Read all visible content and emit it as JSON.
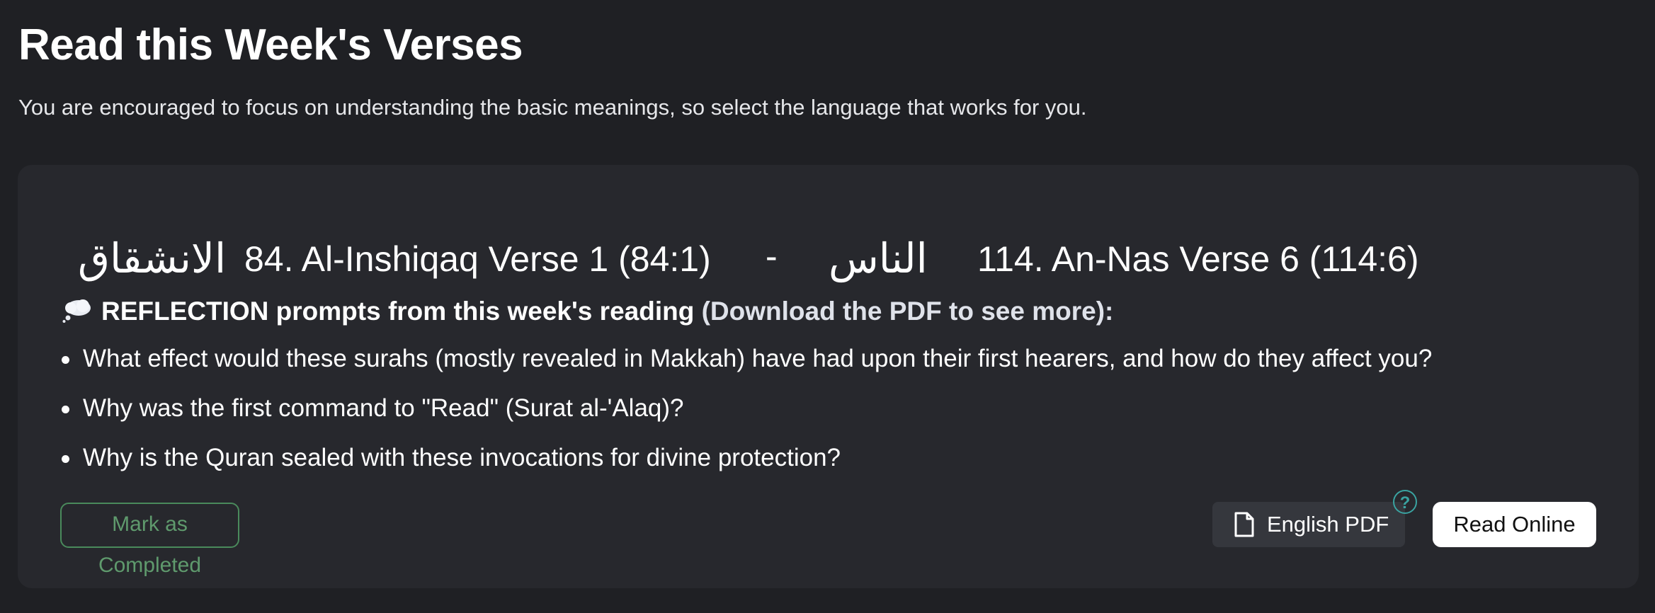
{
  "header": {
    "title": "Read this Week's Verses",
    "subtitle": "You are encouraged to focus on understanding the basic meanings, so select the language that works for you."
  },
  "card": {
    "range": {
      "start": {
        "arabic_name": "الانشقاق",
        "label": "84. Al-Inshiqaq Verse 1 (84:1)"
      },
      "separator": "-",
      "end": {
        "arabic_name": "الناس",
        "label": "114. An-Nas Verse 6 (114:6)"
      }
    },
    "reflection": {
      "icon": "thought-bubble-icon",
      "heading": "REFLECTION prompts from this week's reading",
      "download_note": "(Download the PDF to see more):",
      "prompts": [
        "What effect would these surahs (mostly revealed in Makkah) have had upon their first hearers, and how do they affect you?",
        "Why was the first command to \"Read\" (Surat al-'Alaq)?",
        "Why is the Quran sealed with these invocations for divine protection?"
      ]
    },
    "actions": {
      "mark_completed": "Mark as Completed",
      "english_pdf": "English PDF",
      "help": "?",
      "read_online": "Read Online"
    }
  },
  "colors": {
    "background": "#1f2024",
    "card": "#27282d",
    "mark_completed": "#5f9a6d",
    "help_accent": "#3aa3a1",
    "read_online_bg": "#ffffff"
  }
}
